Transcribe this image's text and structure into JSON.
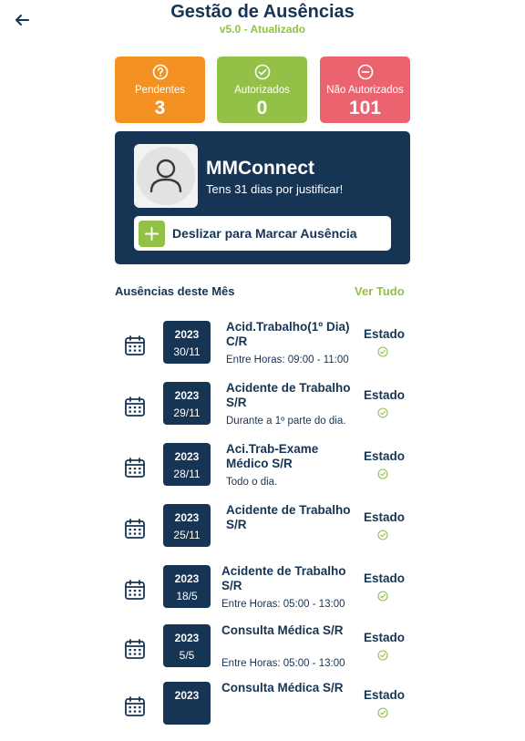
{
  "header": {
    "title": "Gestão de Ausências",
    "version": "v5.0 - Atualizado"
  },
  "stats": [
    {
      "label": "Pendentes",
      "value": "3",
      "icon": "question-circle-icon",
      "color": "#f39223"
    },
    {
      "label": "Autorizados",
      "value": "0",
      "icon": "check-circle-icon",
      "color": "#93c148"
    },
    {
      "label": "Não Autorizados",
      "value": "101",
      "icon": "minus-circle-icon",
      "color": "#ec6370"
    }
  ],
  "profile": {
    "name": "MMConnect",
    "message": "Tens 31 dias por justificar!",
    "slide_label": "Deslizar para Marcar Ausência"
  },
  "absences": {
    "section_title": "Ausências deste Mês",
    "see_all": "Ver Tudo",
    "items": [
      {
        "year": "2023",
        "date": "30/11",
        "title": "Acid.Trabalho(1º Dia) C/R",
        "detail": "Entre Horas: 09:00 - 11:00",
        "status": "Estado"
      },
      {
        "year": "2023",
        "date": "29/11",
        "title": "Acidente de Trabalho S/R",
        "detail": "Durante a 1º parte do dia.",
        "status": "Estado"
      },
      {
        "year": "2023",
        "date": "28/11",
        "title": "Aci.Trab-Exame Médico S/R",
        "detail": "Todo o dia.",
        "status": "Estado"
      },
      {
        "year": "2023",
        "date": "25/11",
        "title": "Acidente de Trabalho S/R",
        "detail": "",
        "status": "Estado"
      },
      {
        "year": "2023",
        "date": "18/5",
        "title": "Acidente de Trabalho S/R",
        "detail": "Entre Horas: 05:00 - 13:00",
        "status": "Estado"
      },
      {
        "year": "2023",
        "date": "5/5",
        "title": "Consulta Médica S/R",
        "detail": "Entre Horas: 05:00 - 13:00",
        "status": "Estado"
      },
      {
        "year": "2023",
        "date": "",
        "title": "Consulta Médica S/R",
        "detail": "",
        "status": "Estado"
      }
    ]
  },
  "colors": {
    "navy": "#163454",
    "green": "#93c148",
    "orange": "#f39223",
    "red": "#ec6370"
  }
}
